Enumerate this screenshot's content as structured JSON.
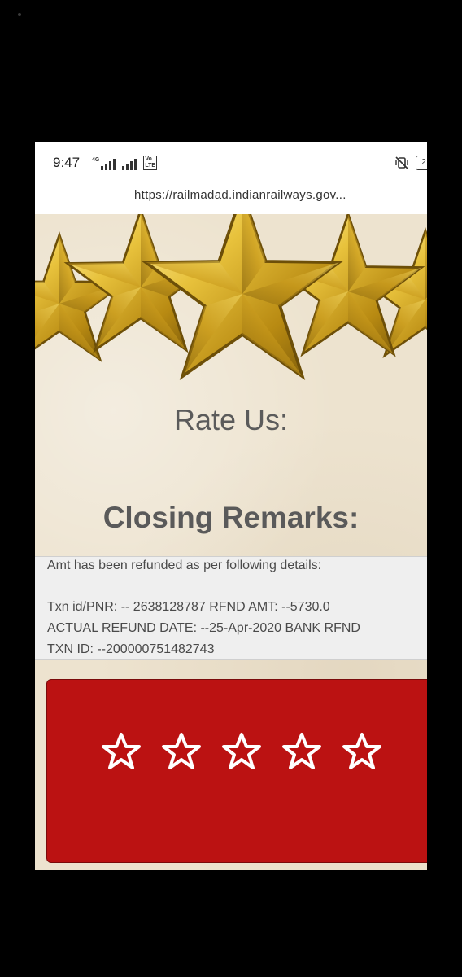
{
  "status_bar": {
    "time": "9:47",
    "network_tag": "4G",
    "volte_tag": "VoLTE",
    "battery": "2"
  },
  "browser": {
    "url": "https://railmadad.indianrailways.gov..."
  },
  "banner": {
    "icon": "gold-stars-banner"
  },
  "page": {
    "rate_us": "Rate Us:",
    "closing_remarks_title": "Closing Remarks:"
  },
  "remarks": {
    "line1": "Amt has been refunded as per following details:",
    "line2": "Txn id/PNR: -- 2638128787   RFND AMT: --5730.0",
    "line3": "ACTUAL REFUND DATE: --25-Apr-2020       BANK RFND",
    "line4": "TXN ID: --200000751482743"
  },
  "rating": {
    "star_count": 5,
    "panel_color": "#bb1212",
    "star_color": "#ffffff"
  }
}
